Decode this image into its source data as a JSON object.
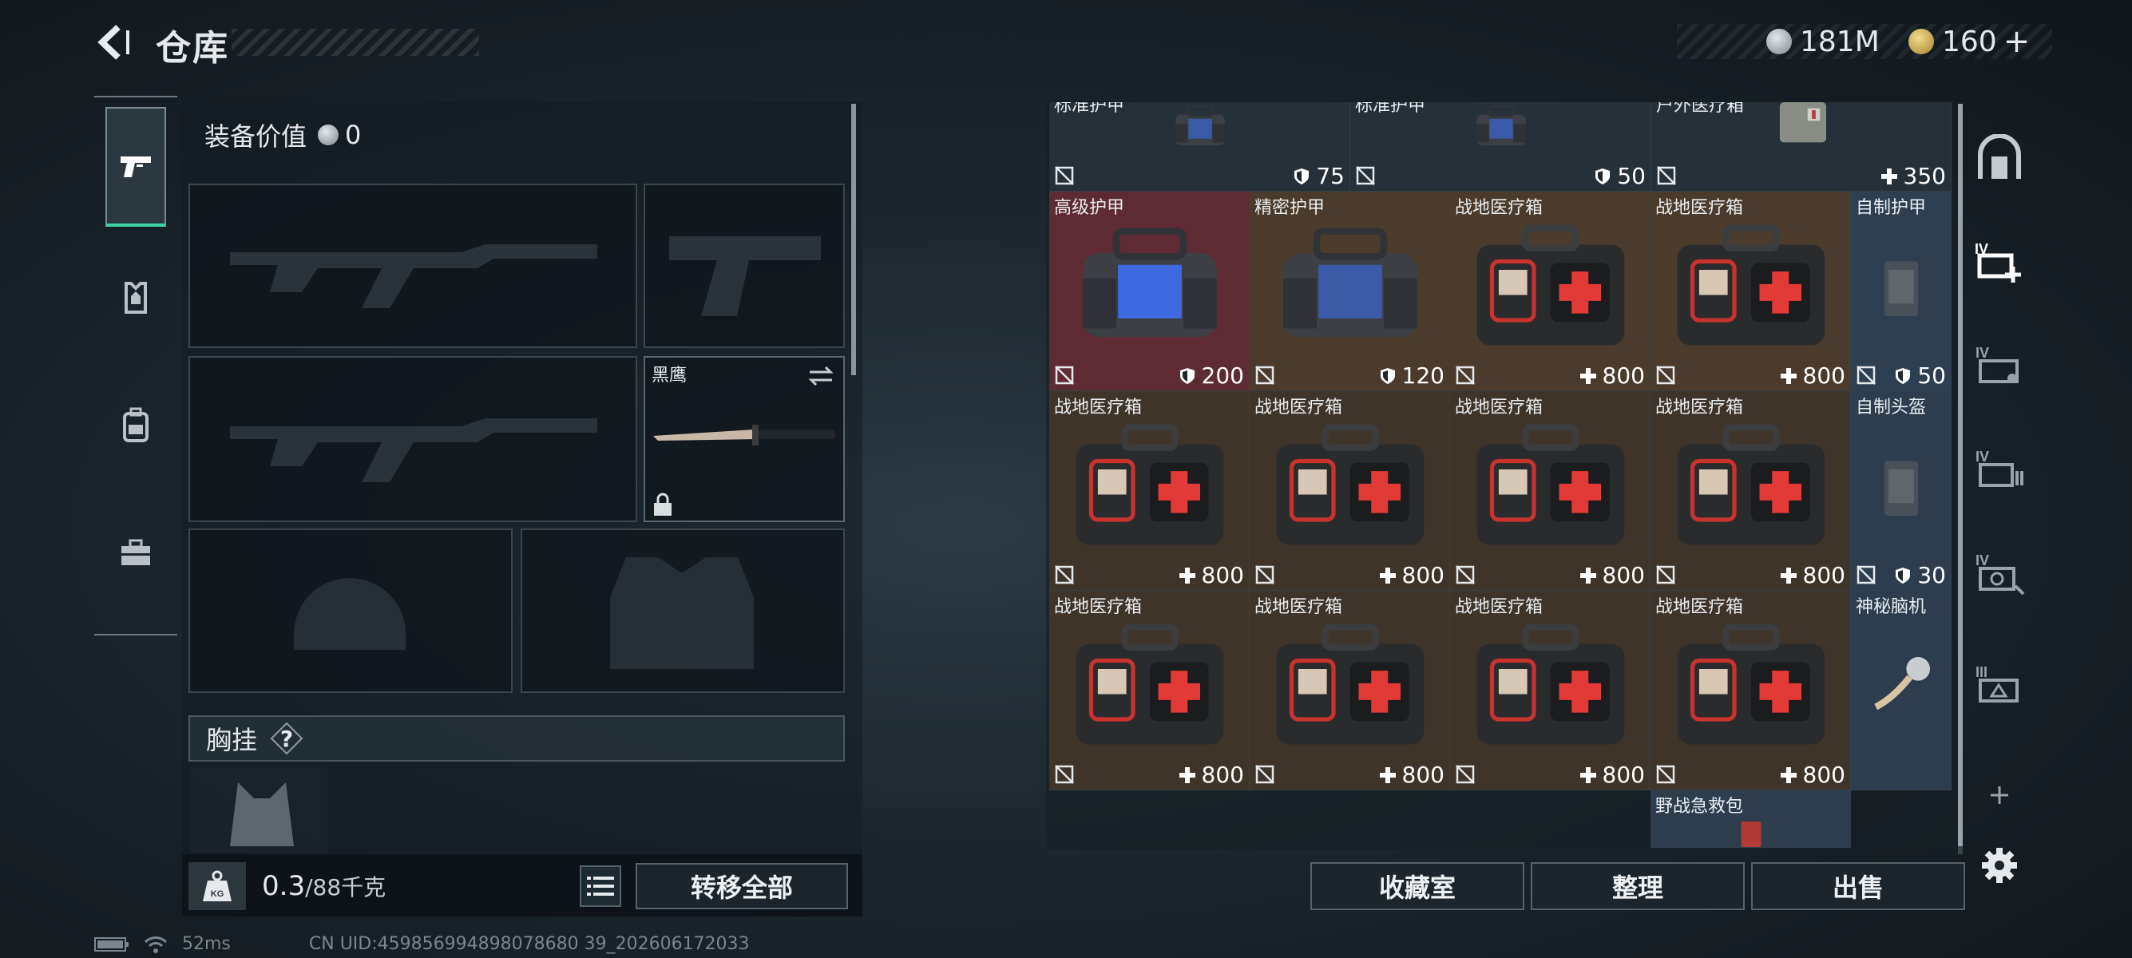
{
  "header": {
    "title": "仓库",
    "currencies": [
      {
        "icon": "silver-coin-icon",
        "value": "181M"
      },
      {
        "icon": "gold-coin-icon",
        "value": "160"
      }
    ],
    "add_label": "+"
  },
  "left_tabs": [
    {
      "icon": "pistol-icon",
      "active": true
    },
    {
      "icon": "armor-vest-icon",
      "active": false
    },
    {
      "icon": "backpack-icon",
      "active": false
    },
    {
      "icon": "toolbox-icon",
      "active": false
    }
  ],
  "equipment": {
    "value_label": "装备价值",
    "value": "0",
    "knife_slot_label": "黑鹰",
    "chest_rig_label": "胸挂",
    "help_label": "?",
    "weight_current": "0.3",
    "weight_capacity": "/88千克",
    "weight_icon_label": "KG",
    "transfer_all_label": "转移全部"
  },
  "grid": {
    "rows": [
      [
        {
          "name": "标准护甲",
          "icon": "armor-bag-icon",
          "stat_icon": "shield-icon",
          "stat": "75",
          "bound": true
        },
        {
          "name": "标准护甲",
          "icon": "armor-bag-icon",
          "stat_icon": "shield-icon",
          "stat": "50",
          "bound": true
        },
        {
          "name": "户外医疗箱",
          "icon": "outdoor-medkit-icon",
          "stat_icon": "plus-icon",
          "stat": "350",
          "bound": true
        }
      ],
      [
        {
          "name": "高级护甲",
          "icon": "armor-bag-icon",
          "stat_icon": "shield-icon",
          "stat": "200",
          "bound": true,
          "bg": "#5e2a34"
        },
        {
          "name": "精密护甲",
          "icon": "armor-bag-icon",
          "stat_icon": "shield-icon",
          "stat": "120",
          "bound": true,
          "bg": "#4b3b2c"
        },
        {
          "name": "战地医疗箱",
          "icon": "first-aid-kit-icon",
          "stat_icon": "plus-icon",
          "stat": "800",
          "bound": true,
          "bg": "#4b3b2c"
        },
        {
          "name": "战地医疗箱",
          "icon": "first-aid-kit-icon",
          "stat_icon": "plus-icon",
          "stat": "800",
          "bound": true,
          "bg": "#4b3b2c"
        },
        {
          "name": "自制护甲",
          "icon": "homemade-armor-icon",
          "stat_icon": "shield-icon",
          "stat": "50",
          "bound": true,
          "bg": "#2e3f52"
        }
      ],
      [
        {
          "name": "战地医疗箱",
          "icon": "first-aid-kit-icon",
          "stat_icon": "plus-icon",
          "stat": "800",
          "bound": true
        },
        {
          "name": "战地医疗箱",
          "icon": "first-aid-kit-icon",
          "stat_icon": "plus-icon",
          "stat": "800",
          "bound": true
        },
        {
          "name": "战地医疗箱",
          "icon": "first-aid-kit-icon",
          "stat_icon": "plus-icon",
          "stat": "800",
          "bound": true
        },
        {
          "name": "战地医疗箱",
          "icon": "first-aid-kit-icon",
          "stat_icon": "plus-icon",
          "stat": "800",
          "bound": true
        },
        {
          "name": "自制头盔",
          "icon": "homemade-helmet-icon",
          "stat_icon": "shield-icon",
          "stat": "30",
          "bound": true
        }
      ],
      [
        {
          "name": "战地医疗箱",
          "icon": "first-aid-kit-icon",
          "stat_icon": "plus-icon",
          "stat": "800",
          "bound": true
        },
        {
          "name": "战地医疗箱",
          "icon": "first-aid-kit-icon",
          "stat_icon": "plus-icon",
          "stat": "800",
          "bound": true
        },
        {
          "name": "战地医疗箱",
          "icon": "first-aid-kit-icon",
          "stat_icon": "plus-icon",
          "stat": "800",
          "bound": true
        },
        {
          "name": "战地医疗箱",
          "icon": "first-aid-kit-icon",
          "stat_icon": "plus-icon",
          "stat": "800",
          "bound": true
        },
        {
          "name": "神秘脑机",
          "icon": "brain-chip-icon",
          "stat_icon": "",
          "stat": "",
          "bound": false
        }
      ],
      [
        {
          "name": "野战急救包",
          "icon": "field-aid-bag-icon",
          "stat_icon": "",
          "stat": "",
          "bound": false
        }
      ]
    ]
  },
  "grid_buttons": {
    "vault_label": "收藏室",
    "sort_label": "整理",
    "sell_label": "出售"
  },
  "right_rail": {
    "icons": [
      "vault-door-icon",
      "add-storage-icon",
      "storage-iv-1-icon",
      "storage-iv-2-icon",
      "storage-iv-3-icon",
      "storage-iii-icon",
      "add-icon",
      "settings-icon"
    ],
    "tier_labels": [
      "IV",
      "IV",
      "IV",
      "IV",
      "III"
    ]
  },
  "status": {
    "ping": "52ms",
    "uid": "CN UID:459856994898078680 39_202606172033"
  }
}
